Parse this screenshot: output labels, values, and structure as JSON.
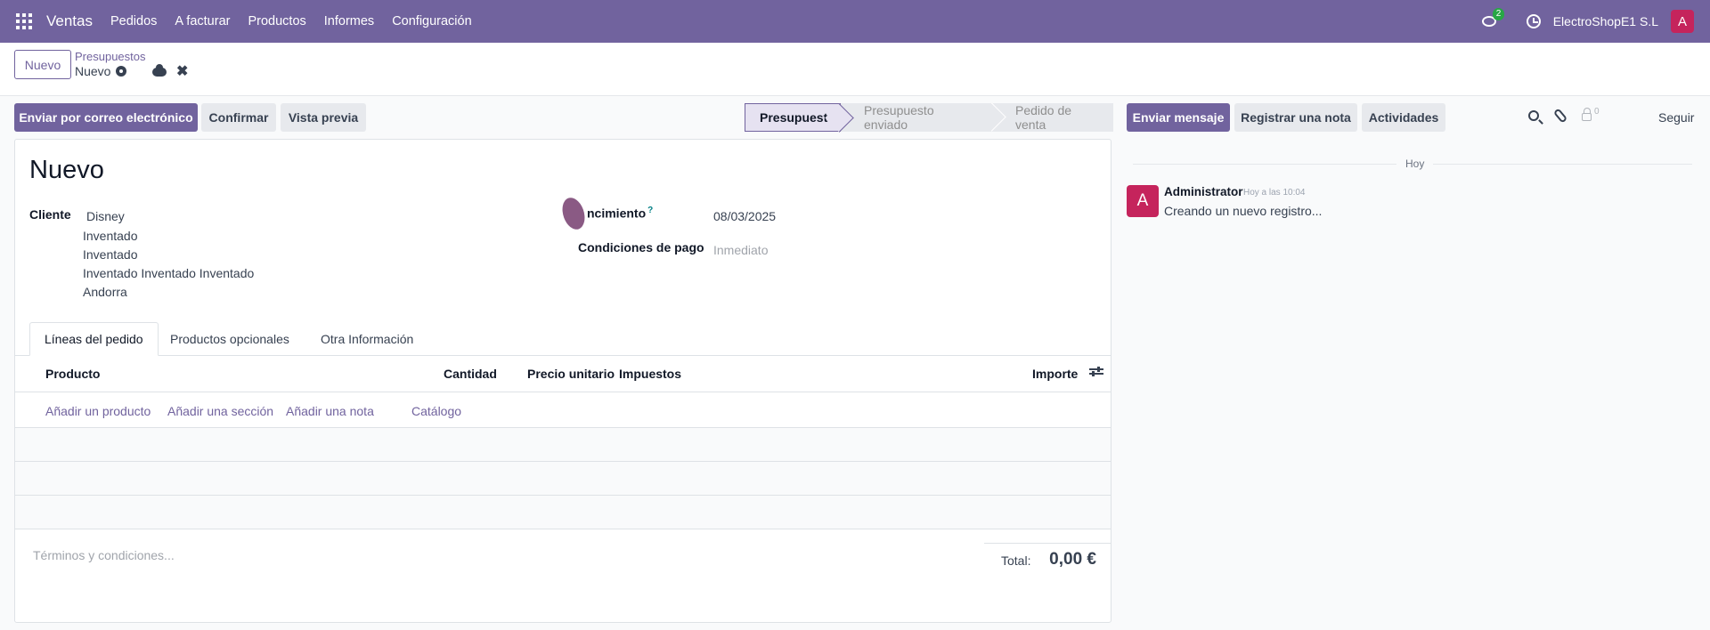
{
  "navbar": {
    "app_name": "Ventas",
    "menu": [
      "Pedidos",
      "A facturar",
      "Productos",
      "Informes",
      "Configuración"
    ],
    "messages_badge": "2",
    "company": "ElectroShopE1 S.L",
    "user_initial": "A"
  },
  "control": {
    "new_button": "Nuevo",
    "breadcrumb_parent": "Presupuestos",
    "breadcrumb_current": "Nuevo"
  },
  "actions": {
    "send_email": "Enviar por correo electrónico",
    "confirm": "Confirmar",
    "preview": "Vista previa"
  },
  "stages": [
    "Presupuesto",
    "Presupuesto enviado",
    "Pedido de venta"
  ],
  "form": {
    "title": "Nuevo",
    "customer_label": "Cliente",
    "customer_name": "Disney",
    "address": [
      "Inventado",
      "Inventado",
      "Inventado Inventado Inventado",
      "Andorra"
    ],
    "expiration_label": "ncimiento",
    "expiration_tooltip": "?",
    "expiration_value": "08/03/2025",
    "payment_terms_label": "Condiciones de pago",
    "payment_terms_placeholder": "Inmediato"
  },
  "tabs": [
    "Líneas del pedido",
    "Productos opcionales",
    "Otra Información"
  ],
  "order_lines": {
    "columns": {
      "product": "Producto",
      "quantity": "Cantidad",
      "unit_price": "Precio unitario",
      "taxes": "Impuestos",
      "amount": "Importe"
    },
    "add_links": [
      "Añadir un producto",
      "Añadir una sección",
      "Añadir una nota",
      "Catálogo"
    ]
  },
  "footer": {
    "terms_placeholder": "Términos y condiciones...",
    "total_label": "Total:",
    "total_value": "0,00 €"
  },
  "chatter": {
    "send_message": "Enviar mensaje",
    "log_note": "Registrar una nota",
    "activities": "Actividades",
    "followers_count": "0",
    "follow": "Seguir",
    "day_label": "Hoy",
    "message": {
      "avatar_initial": "A",
      "author": "Administrator",
      "time": "Hoy a las 10:04",
      "body": "Creando un nuevo registro..."
    }
  }
}
